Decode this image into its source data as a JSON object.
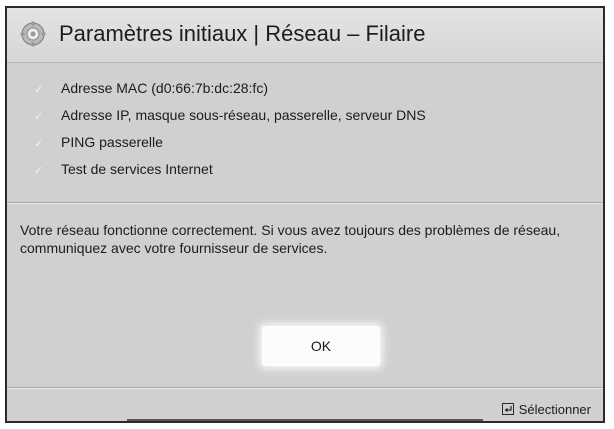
{
  "dialog": {
    "title": "Paramètres initiaux | Réseau – Filaire",
    "title_icon": "gear-icon",
    "checks": [
      {
        "label": "Adresse MAC (d0:66:7b:dc:28:fc)",
        "status": "passed"
      },
      {
        "label": "Adresse IP, masque sous-réseau, passerelle, serveur DNS",
        "status": "passed"
      },
      {
        "label": "PING passerelle",
        "status": "passed"
      },
      {
        "label": "Test de services Internet",
        "status": "passed"
      }
    ],
    "message": "Votre réseau fonctionne correctement. Si vous avez toujours des problèmes de réseau, communiquez avec votre fournisseur de services.",
    "ok_label": "OK"
  },
  "footer": {
    "select_icon": "enter-key-icon",
    "select_label": "Sélectionner"
  },
  "colors": {
    "panel_background": "#d0d0d0",
    "check_mark": "#f2f2f2",
    "text": "#1c1c1c"
  }
}
